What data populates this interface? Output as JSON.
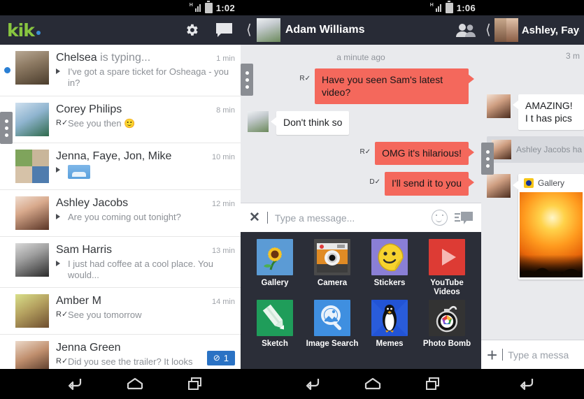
{
  "panels": {
    "left": {
      "status": {
        "time": "1:02",
        "network": "H"
      },
      "appbar": {
        "logo": "kik",
        "settings_icon": "gear-icon",
        "compose_icon": "chat-bubble-icon"
      },
      "chats": [
        {
          "name": "Chelsea",
          "name_suffix": " is typing...",
          "time": "1 min",
          "preview": "I've got a spare ticket for Osheaga - you in?",
          "marker": "triangle",
          "unread": true,
          "avatar": "av-chelsea"
        },
        {
          "name": "Corey Philips",
          "name_suffix": "",
          "time": "8 min",
          "preview": "See you then 🙂",
          "marker": "read-receipt",
          "unread": false,
          "avatar": "av-corey"
        },
        {
          "name": "Jenna, Faye, Jon, Mike",
          "name_suffix": "",
          "time": "10 min",
          "preview": "",
          "marker": "triangle",
          "image_preview": true,
          "unread": false,
          "avatar": "av-group4"
        },
        {
          "name": "Ashley Jacobs",
          "name_suffix": "",
          "time": "12 min",
          "preview": "Are you coming out tonight?",
          "marker": "triangle",
          "unread": false,
          "avatar": "av-ashley"
        },
        {
          "name": "Sam Harris",
          "name_suffix": "",
          "time": "13 min",
          "preview": "I just had coffee at a cool place. You would...",
          "marker": "triangle",
          "unread": false,
          "avatar": "av-sam"
        },
        {
          "name": "Amber M",
          "name_suffix": "",
          "time": "14 min",
          "preview": "See you tomorrow",
          "marker": "read-receipt",
          "unread": false,
          "avatar": "av-amber"
        },
        {
          "name": "Jenna Green",
          "name_suffix": "",
          "time": "",
          "badge": "1",
          "preview": "Did you see the trailer? It looks",
          "marker": "read-receipt",
          "unread": false,
          "avatar": "av-jenna"
        }
      ]
    },
    "middle": {
      "status": {
        "time": "1:06",
        "network": "H"
      },
      "header": {
        "back_icon": "back-chevron-icon",
        "title": "Adam Williams",
        "action_icon": "people-icon",
        "avatar": "av-adam"
      },
      "timestamp": "a minute ago",
      "messages": [
        {
          "dir": "out",
          "text": "Have you seen Sam's latest video?",
          "receipt": "R"
        },
        {
          "dir": "in",
          "text": "Don't think so",
          "avatar": "av-adam"
        },
        {
          "dir": "out",
          "text": "OMG it's hilarious!",
          "receipt": "R"
        },
        {
          "dir": "out",
          "text": "I'll send it to you",
          "receipt": "D"
        }
      ],
      "input": {
        "close_icon": "close-icon",
        "placeholder": "Type a message...",
        "emoji_icon": "smiley-icon",
        "sticker_icon": "chat-bubble-icon"
      },
      "tray": [
        {
          "label": "Gallery",
          "icon": "gallery-icon"
        },
        {
          "label": "Camera",
          "icon": "camera-icon"
        },
        {
          "label": "Stickers",
          "icon": "sticker-icon"
        },
        {
          "label": "YouTube Videos",
          "icon": "youtube-icon"
        },
        {
          "label": "Sketch",
          "icon": "pencil-icon"
        },
        {
          "label": "Image Search",
          "icon": "magnifier-icon"
        },
        {
          "label": "Memes",
          "icon": "penguin-icon"
        },
        {
          "label": "Photo Bomb",
          "icon": "bomb-icon"
        }
      ]
    },
    "right": {
      "header": {
        "back_icon": "back-chevron-icon",
        "title": "Ashley, Faye",
        "avatar": "av-ashfaye"
      },
      "timestamp": "3 m",
      "messages": [
        {
          "dir": "in",
          "text": "AMAZING! I t has pics",
          "avatar": "av-ashley2"
        }
      ],
      "system_row": {
        "text": "Ashley Jacobs ha",
        "avatar": "av-ashley2"
      },
      "gallery_card": {
        "label": "Gallery",
        "badge_icon": "gallery-badge-icon"
      },
      "input": {
        "plus_icon": "plus-icon",
        "placeholder": "Type a messa"
      }
    }
  },
  "navbar": {
    "groups": [
      {
        "buttons": [
          "back-icon",
          "home-icon",
          "recents-icon"
        ]
      },
      {
        "buttons": [
          "back-icon",
          "home-icon",
          "recents-icon"
        ]
      },
      {
        "buttons": [
          "back-icon"
        ]
      }
    ]
  },
  "colors": {
    "appbar": "#282b36",
    "accent_green": "#88c540",
    "accent_blue": "#3b8fd4",
    "outgoing_bubble": "#f4685c",
    "badge_blue": "#2a72c4",
    "conv_bg": "#e9eaed"
  }
}
